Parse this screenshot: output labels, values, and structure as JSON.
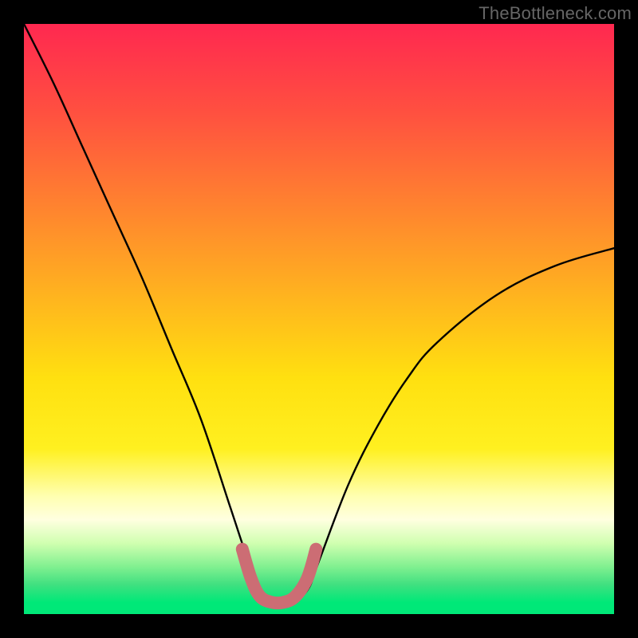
{
  "watermark": "TheBottleneck.com",
  "chart_data": {
    "type": "line",
    "title": "",
    "xlabel": "",
    "ylabel": "",
    "xlim": [
      0,
      100
    ],
    "ylim": [
      0,
      100
    ],
    "series": [
      {
        "name": "bottleneck-curve",
        "x": [
          0,
          5,
          10,
          15,
          20,
          25,
          30,
          35,
          38,
          40,
          42,
          45,
          48,
          50,
          55,
          60,
          65,
          70,
          80,
          90,
          100
        ],
        "values": [
          100,
          90,
          79,
          68,
          57,
          45,
          33,
          18,
          9,
          4,
          2,
          2,
          4,
          9,
          22,
          32,
          40,
          46,
          54,
          59,
          62
        ]
      }
    ],
    "highlight": {
      "name": "optimal-range",
      "x": [
        37,
        38.5,
        40,
        42,
        44,
        46,
        48,
        49.5
      ],
      "values": [
        11,
        6,
        3,
        2,
        2,
        3,
        6,
        11
      ]
    }
  }
}
